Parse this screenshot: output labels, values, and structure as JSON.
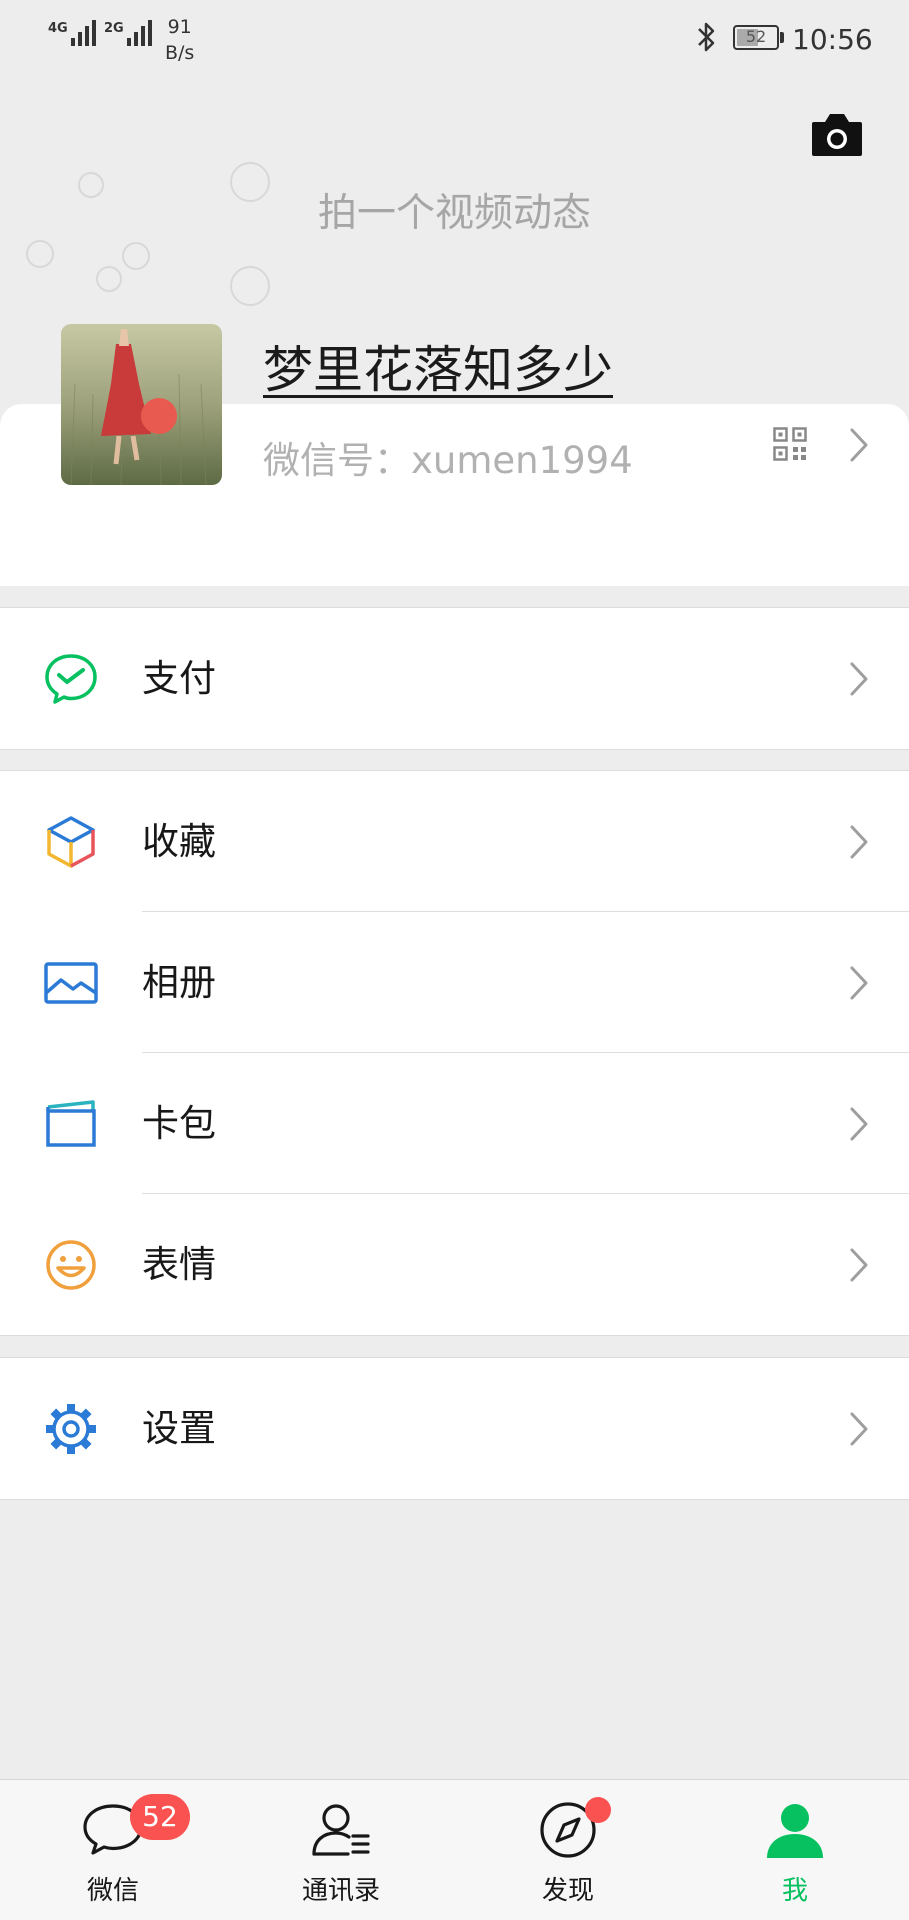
{
  "status_bar": {
    "sig1_label": "4G",
    "sig2_label": "2G",
    "net_speed_value": "91",
    "net_speed_unit": "B/s",
    "battery": "52",
    "time": "10:56"
  },
  "header": {
    "video_hint": "拍一个视频动态",
    "camera_icon": "camera-icon"
  },
  "profile": {
    "nickname": "梦里花落知多少",
    "wechat_id": "微信号：xumen1994",
    "qr_icon": "qr-code-icon"
  },
  "menu": {
    "pay": {
      "label": "支付",
      "icon": "wechat-pay-icon",
      "color": "#07c160"
    },
    "favorites": {
      "label": "收藏",
      "icon": "favorites-cube-icon"
    },
    "album": {
      "label": "相册",
      "icon": "album-icon",
      "color": "#2b7bd6"
    },
    "cards": {
      "label": "卡包",
      "icon": "card-wallet-icon",
      "color": "#2b7bd6"
    },
    "stickers": {
      "label": "表情",
      "icon": "sticker-smile-icon",
      "color": "#f0a03c"
    },
    "settings": {
      "label": "设置",
      "icon": "settings-gear-icon",
      "color": "#2b7bd6"
    }
  },
  "tabbar": {
    "chats": {
      "label": "微信",
      "badge": "52"
    },
    "contacts": {
      "label": "通讯录"
    },
    "discover": {
      "label": "发现"
    },
    "me": {
      "label": "我",
      "active": true
    }
  },
  "colors": {
    "accent": "#07c160",
    "badge": "#fa5151",
    "background": "#ededed"
  }
}
